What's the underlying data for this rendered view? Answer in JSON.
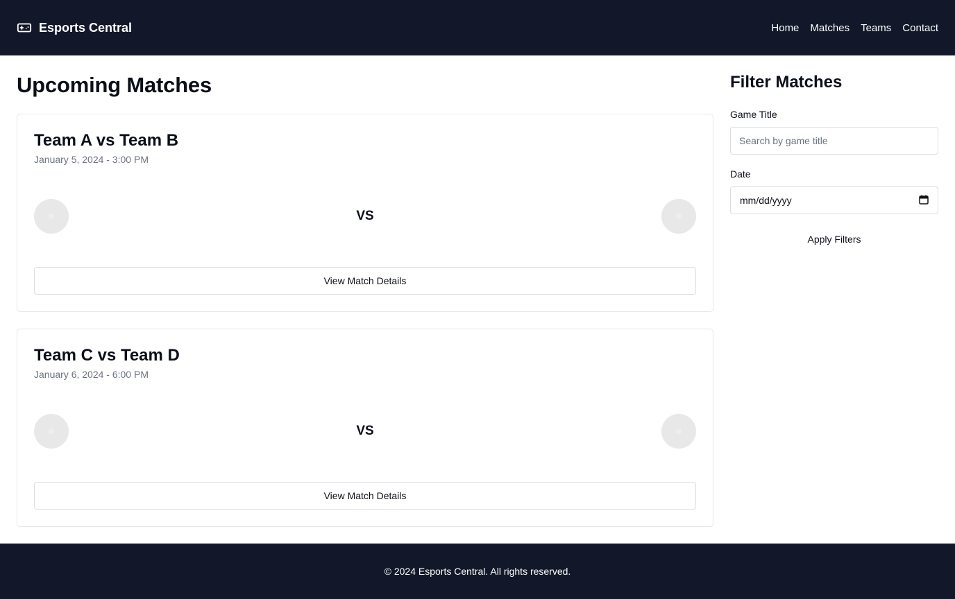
{
  "header": {
    "brand_name": "Esports Central",
    "brand_icon": "gamepad-icon",
    "nav": [
      "Home",
      "Matches",
      "Teams",
      "Contact"
    ]
  },
  "main": {
    "title": "Upcoming Matches",
    "matches": [
      {
        "title": "Team A vs Team B",
        "date": "January 5, 2024 - 3:00 PM",
        "vs": "VS",
        "button": "View Match Details"
      },
      {
        "title": "Team C vs Team D",
        "date": "January 6, 2024 - 6:00 PM",
        "vs": "VS",
        "button": "View Match Details"
      }
    ]
  },
  "sidebar": {
    "title": "Filter Matches",
    "game_title_label": "Game Title",
    "game_title_placeholder": "Search by game title",
    "game_title_value": "",
    "date_label": "Date",
    "date_placeholder": "mm/dd/yyyy",
    "apply_label": "Apply Filters"
  },
  "footer": {
    "text": "© 2024 Esports Central. All rights reserved."
  },
  "colors": {
    "header_bg": "#121829",
    "footer_bg": "#121829",
    "text_primary": "#0b0f19",
    "text_muted": "#6b7280",
    "border": "#e5e7eb"
  }
}
